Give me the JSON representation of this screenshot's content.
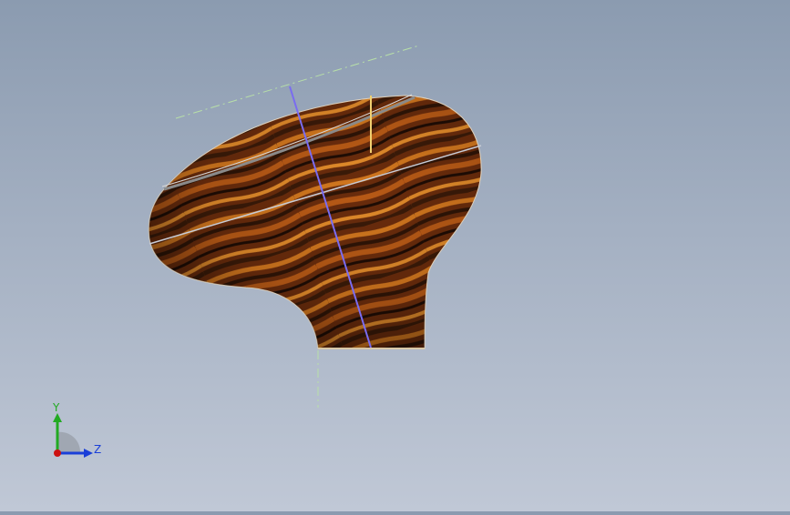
{
  "viewport": {
    "background_top": "#8b9bb0",
    "background_bottom": "#c0c8d6"
  },
  "model": {
    "material": "wood-grain",
    "wood_dark": "#3a1c08",
    "wood_mid": "#8a3f10",
    "wood_light": "#d0761e",
    "axis_line_color": "#7a6cf0",
    "centerline_color": "#b8e0a8"
  },
  "triad": {
    "y_label": "Y",
    "z_label": "Z",
    "y_color": "#22aa22",
    "z_color": "#1a3fd8",
    "x_color": "#cc1111"
  }
}
